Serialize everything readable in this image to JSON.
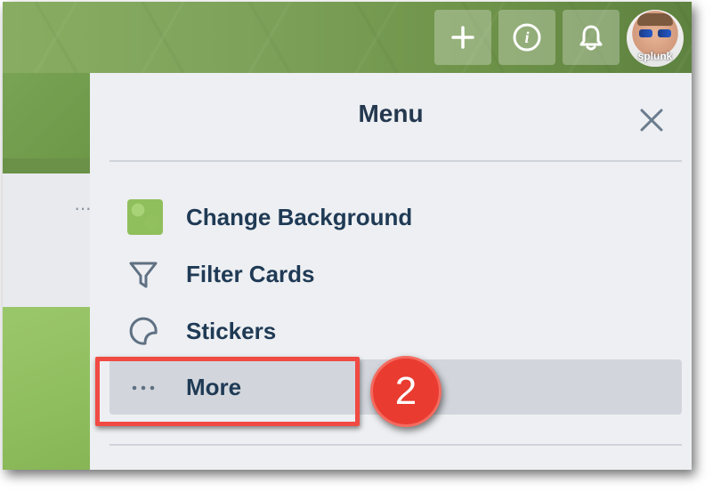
{
  "header": {
    "add_label": "+",
    "info_label": "i",
    "avatar_text": "splunk"
  },
  "menu": {
    "title": "Menu",
    "close_label": "×",
    "items": [
      {
        "label": "Change Background",
        "icon": "background-swatch-icon"
      },
      {
        "label": "Filter Cards",
        "icon": "filter-icon"
      },
      {
        "label": "Stickers",
        "icon": "sticker-icon"
      },
      {
        "label": "More",
        "icon": "more-dots-icon"
      }
    ]
  },
  "board": {
    "list_menu_label": "···"
  },
  "annotation": {
    "step_number": "2"
  },
  "colors": {
    "brand_green": "#6b9148",
    "menu_bg": "#edeff2",
    "highlight_red": "#f04a43",
    "text_dark": "#1f3a55"
  }
}
